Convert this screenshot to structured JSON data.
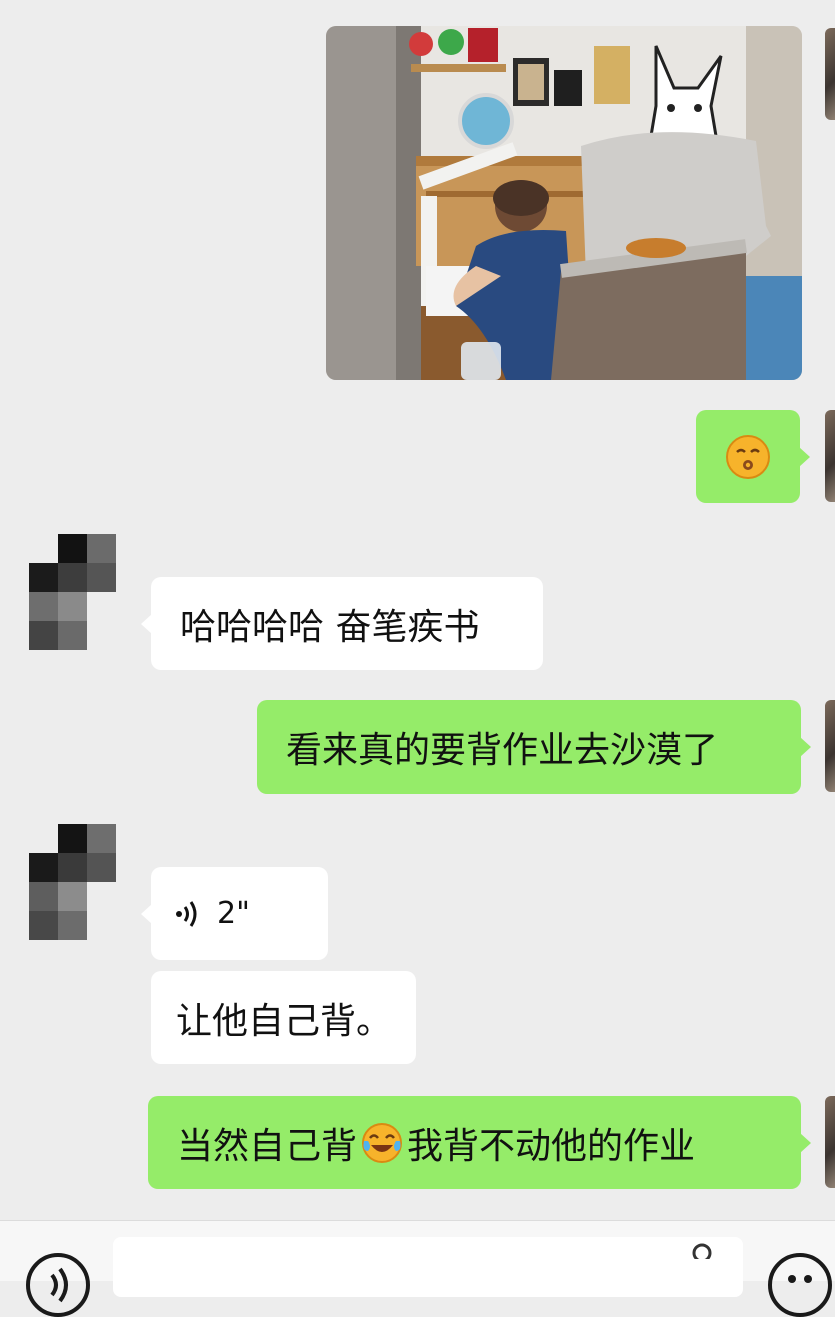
{
  "chat": {
    "messages": [
      {
        "id": "m1",
        "side": "right",
        "type": "image",
        "image_alt": ""
      },
      {
        "id": "m2",
        "side": "right",
        "type": "emoji",
        "emoji": "😗"
      },
      {
        "id": "m3",
        "side": "left",
        "type": "text",
        "text": "哈哈哈哈 奋笔疾书"
      },
      {
        "id": "m4",
        "side": "right",
        "type": "text",
        "text": "看来真的要背作业去沙漠了"
      },
      {
        "id": "m5",
        "side": "left",
        "type": "voice",
        "duration": "2\""
      },
      {
        "id": "m6",
        "side": "left",
        "type": "text",
        "text": "让他自己背。"
      },
      {
        "id": "m7",
        "side": "right",
        "type": "text",
        "text_before": "当然自己背",
        "emoji": "😂",
        "text_after": "我背不动他的作业"
      }
    ]
  },
  "input_bar": {
    "voice_icon": "voice-toggle-icon",
    "emoji_icon": "emoji-face-icon"
  },
  "colors": {
    "background": "#ededed",
    "own_bubble": "#95ec69",
    "other_bubble": "#ffffff"
  }
}
